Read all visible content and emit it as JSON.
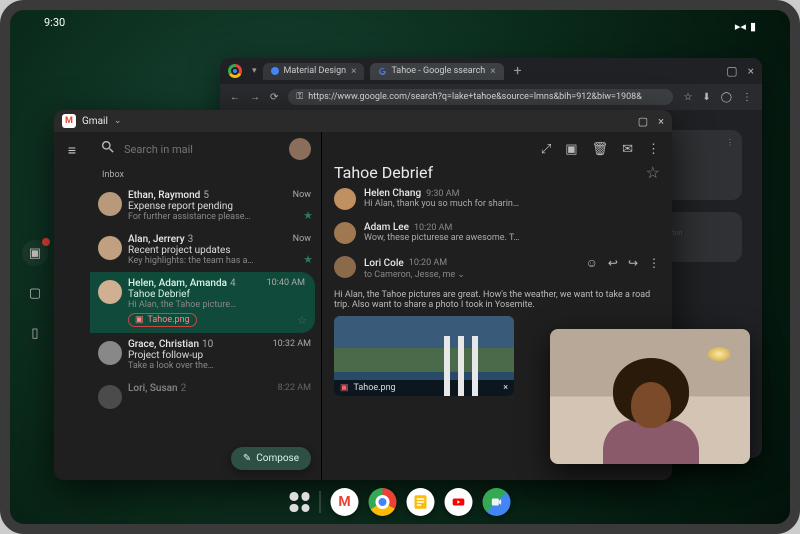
{
  "status": {
    "time": "9:30"
  },
  "browser": {
    "tabs": [
      {
        "label": "Material Design"
      },
      {
        "label": "Tahoe - Google ssearch"
      }
    ],
    "url": "https://www.google.com/search?q=lake+tahoe&source=lmns&bih=912&biw=1908&"
  },
  "gmail": {
    "app_label": "Gmail",
    "search_placeholder": "Search in mail",
    "section": "Inbox",
    "compose_label": "Compose",
    "threads": [
      {
        "from": "Ethan, Raymond",
        "count": "5",
        "time": "Now",
        "subject": "Expense report pending",
        "snippet": "For further assistance please…",
        "starred": true
      },
      {
        "from": "Alan, Jerrery",
        "count": "3",
        "time": "Now",
        "subject": "Recent project updates",
        "snippet": "Key highlights: the team has a…",
        "starred": true
      },
      {
        "from": "Helen, Adam, Amanda",
        "count": "4",
        "time": "10:40 AM",
        "subject": "Tahoe Debrief",
        "snippet": "Hi Alan, the Tahoe picture…",
        "attachment": "Tahoe.png",
        "selected": true
      },
      {
        "from": "Grace, Christian",
        "count": "10",
        "time": "10:32 AM",
        "subject": "Project follow-up",
        "snippet": "Take a look over the…"
      },
      {
        "from": "Lori, Susan",
        "count": "2",
        "time": "8:22 AM",
        "subject": "",
        "snippet": ""
      }
    ],
    "detail": {
      "title": "Tahoe Debrief",
      "messages": [
        {
          "name": "Helen Chang",
          "time": "9:30 AM",
          "text": "Hi Alan, thank you so much for sharin…"
        },
        {
          "name": "Adam Lee",
          "time": "10:20 AM",
          "text": "Wow, these picturese are awesome. T…"
        }
      ],
      "expanded": {
        "name": "Lori Cole",
        "time": "10:20 AM",
        "to": "to Cameron, Jesse, me",
        "body": "Hi Alan, the Tahoe pictures are great. How's the weather, we want to take a road trip. Also want to share a photo I took in Yosemite.",
        "attachment": "Tahoe.png"
      }
    }
  },
  "taskbar": {
    "apps": [
      "gmail",
      "chrome",
      "docs",
      "youtube",
      "meet"
    ]
  }
}
